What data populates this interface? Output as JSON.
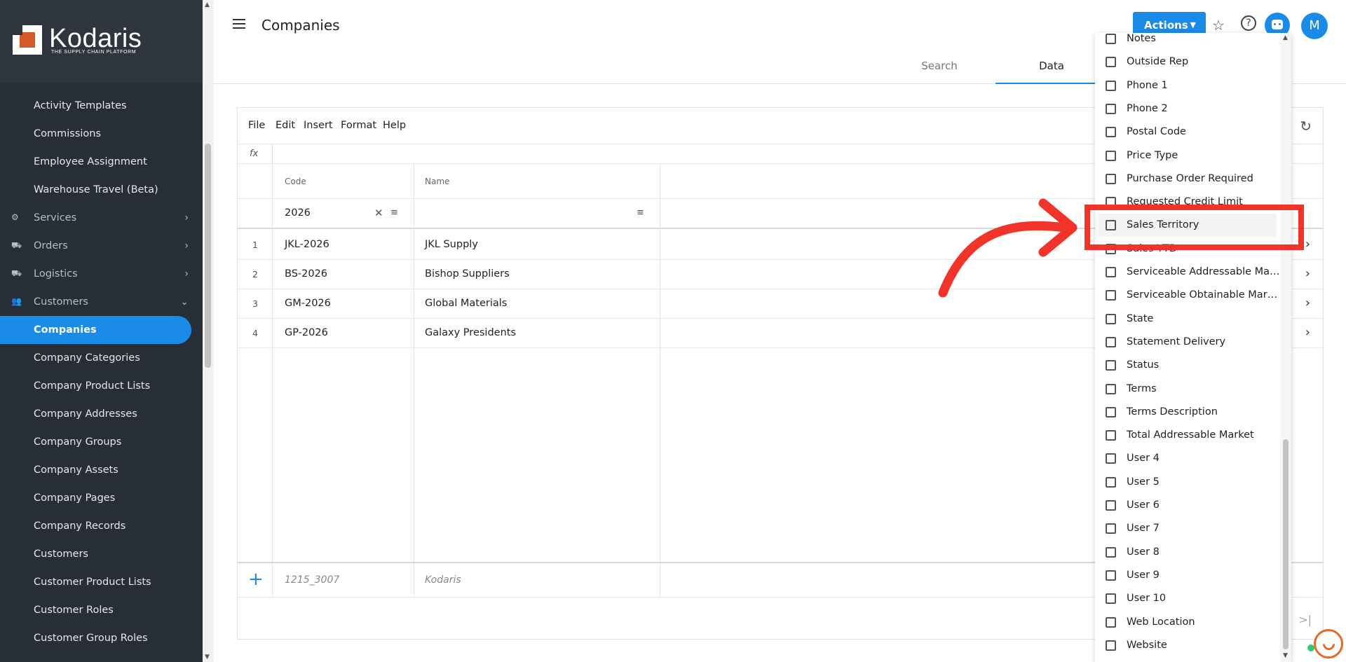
{
  "brand": {
    "name": "Kodaris",
    "tagline": "THE SUPPLY CHAIN PLATFORM",
    "accent": "#1a8ce8",
    "logo_orange": "#d4592a"
  },
  "sidebar": {
    "items": [
      {
        "label": "Activity Templates",
        "kind": "link"
      },
      {
        "label": "Commissions",
        "kind": "link"
      },
      {
        "label": "Employee Assignment",
        "kind": "link"
      },
      {
        "label": "Warehouse Travel (Beta)",
        "kind": "link"
      },
      {
        "label": "Services",
        "kind": "group",
        "icon": "gears-icon",
        "chevron": "›"
      },
      {
        "label": "Orders",
        "kind": "group",
        "icon": "truck-icon",
        "chevron": "›"
      },
      {
        "label": "Logistics",
        "kind": "group",
        "icon": "delivery-icon",
        "chevron": "›"
      },
      {
        "label": "Customers",
        "kind": "group",
        "icon": "people-icon",
        "chevron": "⌄"
      },
      {
        "label": "Companies",
        "kind": "link",
        "active": true
      },
      {
        "label": "Company Categories",
        "kind": "link"
      },
      {
        "label": "Company Product Lists",
        "kind": "link"
      },
      {
        "label": "Company Addresses",
        "kind": "link"
      },
      {
        "label": "Company Groups",
        "kind": "link"
      },
      {
        "label": "Company Assets",
        "kind": "link"
      },
      {
        "label": "Company Pages",
        "kind": "link"
      },
      {
        "label": "Company Records",
        "kind": "link"
      },
      {
        "label": "Customers",
        "kind": "link"
      },
      {
        "label": "Customer Product Lists",
        "kind": "link"
      },
      {
        "label": "Customer Roles",
        "kind": "link"
      },
      {
        "label": "Customer Group Roles",
        "kind": "link"
      }
    ]
  },
  "header": {
    "title": "Companies",
    "tabs": [
      {
        "label": "Search"
      },
      {
        "label": "Data",
        "active": true
      }
    ],
    "actions_label": "Actions",
    "avatar_initial": "M"
  },
  "sheet": {
    "menu": [
      "File",
      "Edit",
      "Insert",
      "Format",
      "Help"
    ],
    "fx_label": "fx",
    "columns": [
      "Code",
      "Name"
    ],
    "filters": {
      "code": "2026",
      "name": ""
    },
    "rows": [
      {
        "num": "1",
        "code": "JKL-2026",
        "name": "JKL Supply"
      },
      {
        "num": "2",
        "code": "BS-2026",
        "name": "Bishop Suppliers"
      },
      {
        "num": "3",
        "code": "GM-2026",
        "name": "Global Materials"
      },
      {
        "num": "4",
        "code": "GP-2026",
        "name": "Galaxy Presidents"
      }
    ],
    "new_row": {
      "code": "1215_3007",
      "name": "Kodaris"
    }
  },
  "column_list": {
    "items": [
      "Notes",
      "Outside Rep",
      "Phone 1",
      "Phone 2",
      "Postal Code",
      "Price Type",
      "Purchase Order Required",
      "Requested Credit Limit",
      "Sales Territory",
      "Sales YTD",
      "Serviceable Addressable Market...",
      "Serviceable Obtainable Market...",
      "State",
      "Statement Delivery",
      "Status",
      "Terms",
      "Terms Description",
      "Total Addressable Market",
      "User 4",
      "User 5",
      "User 6",
      "User 7",
      "User 8",
      "User 9",
      "User 10",
      "Web Location",
      "Website"
    ],
    "highlighted": "Sales Territory"
  },
  "annotation": {
    "color": "#f2332a"
  }
}
